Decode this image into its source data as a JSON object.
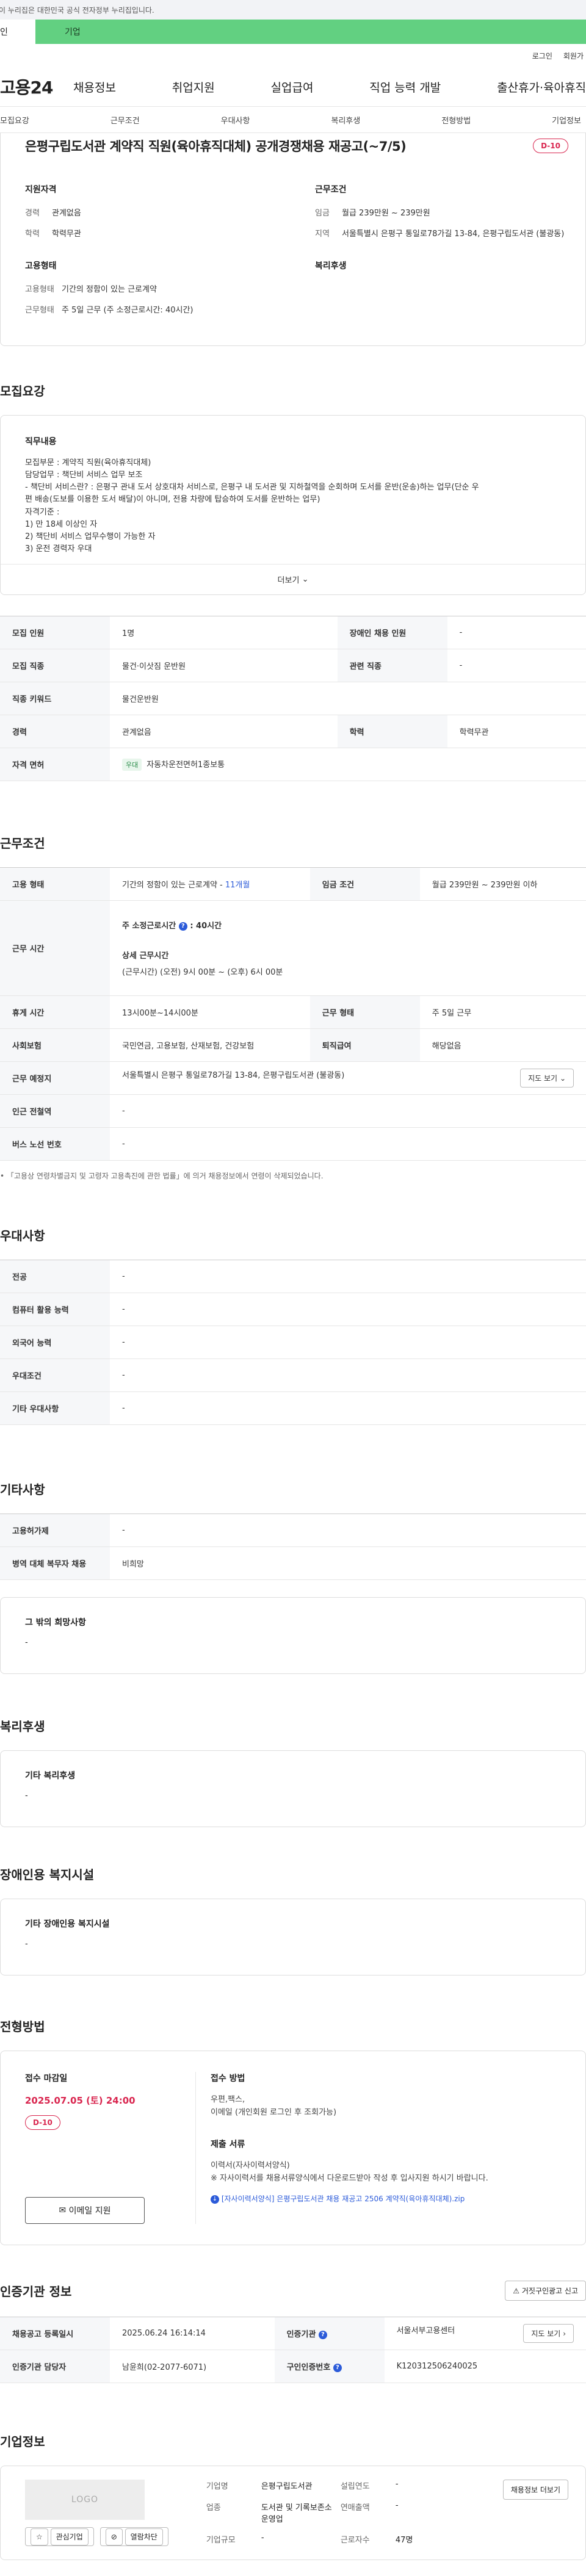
{
  "gov_notice": "이 누리집은 대한민국 공식 전자정부 누리집입니다.",
  "user_type": {
    "individual": "인",
    "corporate": "기업"
  },
  "top_links": [
    "로그인",
    "회원가"
  ],
  "logo": "고용24",
  "gnb": [
    "채용정보",
    "취업지원",
    "실업급여",
    "직업 능력 개발",
    "출산휴가·육아휴직"
  ],
  "subtabs": [
    "모집요강",
    "근무조건",
    "우대사항",
    "복리후생",
    "전형방법",
    "기업정보"
  ],
  "job": {
    "title": "은평구립도서관 계약직 직원(육아휴직대체) 공개경쟁채용 재공고(~7/5)",
    "dday": "D-10"
  },
  "summary": {
    "qualification_title": "지원자격",
    "career_label": "경력",
    "career": "관계없음",
    "education_label": "학력",
    "education": "학력무관",
    "employment_title": "고용형태",
    "emp_type_label": "고용형태",
    "emp_type": "기간의 정함이 있는 근로계약",
    "work_form_label": "근무형태",
    "work_form": "주 5일 근무 (주 소정근로시간: 40시간)",
    "condition_title": "근무조건",
    "wage_label": "임금",
    "wage": "월급 239만원 ~ 239만원",
    "area_label": "지역",
    "area": "서울특별시 은평구 통일로78가길 13-84, 은평구립도서관 (불광동)",
    "welfare_title": "복리후생"
  },
  "recruit": {
    "section_title": "모집요강",
    "duties_title": "직무내용",
    "duties_lines": [
      "모집부문 : 계약직 직원(육아휴직대체)",
      "담당업무 : 책단비 서비스 업무 보조",
      "- 책단비 서비스란? : 은평구 관내 도서 상호대차 서비스로, 은평구 내 도서관 및 지하철역을 순회하며 도서를 운반(운송)하는 업무(단순 우",
      "편 배송(도보를 이용한 도서 배달)이 아니며, 전용 차량에 탑승하여 도서를 운반하는 업무)",
      "자격기준 :",
      "1) 만 18세 이상인 자",
      "2) 책단비 서비스 업무수행이 가능한 자",
      "3) 운전 경력자 우대"
    ],
    "more_label": "더보기",
    "rows": {
      "headcount_k": "모집 인원",
      "headcount": "1명",
      "disabled_k": "장애인 채용 인원",
      "disabled": "-",
      "job_k": "모집 직종",
      "job": "물건·이삿짐 운반원",
      "related_k": "관련 직종",
      "related": "-",
      "keyword_k": "직종 키워드",
      "keyword": "물건운반원",
      "career_k": "경력",
      "career": "관계없음",
      "edu_k": "학력",
      "edu": "학력무관",
      "license_k": "자격 면허",
      "license_tag": "우대",
      "license": "자동차운전면허1종보통"
    }
  },
  "conditions": {
    "section_title": "근무조건",
    "emp_type_k": "고용 형태",
    "emp_type": "기간의 정함이 있는 근로계약 - ",
    "emp_months": "11개월",
    "wage_k": "임금 조건",
    "wage": "월급 239만원 ~ 239만원 이하",
    "time_k": "근무 시간",
    "weekly_hours": "주 소정근로시간",
    "weekly_hours_value": ": 40시간",
    "detail_label": "상세 근무시간",
    "detail_value": "(근무시간) (오전) 9시 00분 ~ (오후) 6시 00분",
    "break_k": "휴게 시간",
    "break": "13시00분~14시00분",
    "work_form_k": "근무 형태",
    "work_form": "주 5일 근무",
    "insurance_k": "사회보험",
    "insurance": "국민연금, 고용보험, 산재보험, 건강보험",
    "severance_k": "퇴직급여",
    "severance": "해당없음",
    "location_k": "근무 예정지",
    "location": "서울특별시 은평구 통일로78가길 13-84, 은평구립도서관 (불광동)",
    "map_btn": "지도 보기",
    "station_k": "인근 전철역",
    "station": "-",
    "bus_k": "버스 노선 번호",
    "bus": "-",
    "note": "「고용상 연령차별금지 및 고령자 고용촉진에 관한 법률」에 의거 채용정보에서 연령이 삭제되었습니다."
  },
  "preference": {
    "section_title": "우대사항",
    "major_k": "전공",
    "major": "-",
    "computer_k": "컴퓨터 활용 능력",
    "computer": "-",
    "language_k": "외국어 능력",
    "language": "-",
    "cond_k": "우대조건",
    "cond": "-",
    "etc_k": "기타 우대사항",
    "etc": "-"
  },
  "etc": {
    "section_title": "기타사항",
    "equip_k": "고용허가제",
    "equip": "-",
    "military_k": "병역 대체 복무자 채용",
    "military": "비희망",
    "other_title": "그 밖의 희망사항",
    "other": "-"
  },
  "welfare": {
    "section_title": "복리후생",
    "title": "기타 복리후생",
    "value": "-"
  },
  "disability": {
    "section_title": "장애인용 복지시설",
    "title": "기타 장애인용 복지시설",
    "value": "-"
  },
  "selection": {
    "section_title": "전형방법",
    "deadline_label": "접수 마감일",
    "deadline": "2025.07.05 (토) 24:00",
    "dday": "D-10",
    "email_btn": "이메일 지원",
    "method_label": "접수 방법",
    "method_lines": [
      "우편,팩스,",
      "이메일 (개인회원 로그인 후 조회가능)"
    ],
    "docs_label": "제출 서류",
    "docs_lines": [
      "이력서(자사이력서양식)",
      "※ 자사이력서를 채용서류양식에서 다운로드받아 작성 후 입사지원 하시기 바랍니다."
    ],
    "file_link": "[자사이력서양식] 은평구립도서관 채용 재공고 2506 계약직(육아휴직대체).zip"
  },
  "cert": {
    "section_title": "인증기관 정보",
    "report_btn": "거짓구인광고 신고",
    "reg_k": "채용공고 등록일시",
    "reg": "2025.06.24 16:14:14",
    "agency_k": "인증기관",
    "agency": "서울서부고용센터",
    "map_btn": "지도 보기",
    "manager_k": "인증기관 담당자",
    "manager": "남윤희(02-2077-6071)",
    "no_k": "구인인증번호",
    "no": "K120312506240025"
  },
  "company": {
    "section_title": "기업정보",
    "logo_placeholder": "LOGO",
    "fav_btn": "관심기업",
    "block_btn": "열람차단",
    "name_k": "기업명",
    "name": "은평구립도서관",
    "industry_k": "업종",
    "industry": "도서관 및 기록보존소 운영업",
    "size_k": "기업규모",
    "size": "-",
    "founded_k": "설립연도",
    "founded": "-",
    "sales_k": "연매출액",
    "sales": "-",
    "employees_k": "근로자수",
    "employees": "47명",
    "info_btn": "채용정보 더보기"
  }
}
